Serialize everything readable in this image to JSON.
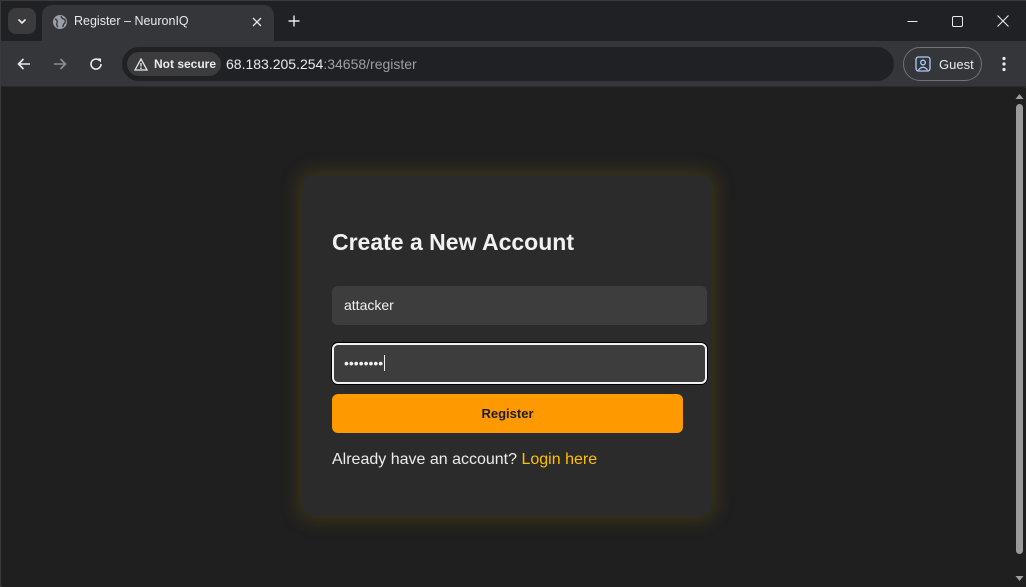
{
  "browser": {
    "tab_title": "Register – NeuronIQ",
    "security_chip": "Not secure",
    "url_host": "68.183.205.254",
    "url_rest": ":34658/register",
    "profile_label": "Guest"
  },
  "icons": {
    "tab_search": "chevron-down-icon",
    "favicon": "globe-icon",
    "tab_close": "close-icon",
    "new_tab": "plus-icon",
    "minimize": "minimize-icon",
    "maximize": "maximize-icon",
    "close_window": "close-icon",
    "back": "arrow-left-icon",
    "forward": "arrow-right-icon",
    "reload": "reload-icon",
    "warning": "warning-icon",
    "profile": "person-icon",
    "menu": "kebab-menu-icon"
  },
  "form": {
    "heading": "Create a New Account",
    "username_value": "attacker",
    "password_mask": "••••••••",
    "register_label": "Register",
    "login_prompt": "Already have an account?",
    "login_link": "Login here"
  },
  "colors": {
    "accent": "#ff9900",
    "link": "#ffc000",
    "card_bg": "#2b2b2b",
    "page_bg": "#1f1f1f"
  }
}
